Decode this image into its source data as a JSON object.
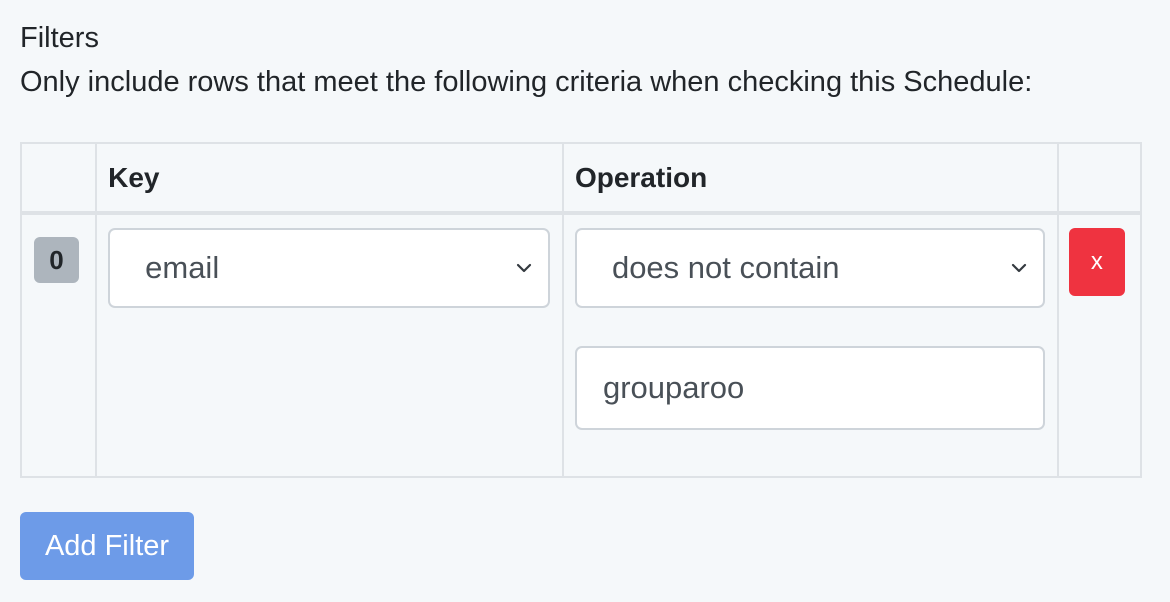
{
  "section": {
    "title": "Filters",
    "description": "Only include rows that meet the following criteria when checking this Schedule:"
  },
  "table": {
    "headers": {
      "index": "",
      "key": "Key",
      "operation": "Operation",
      "actions": ""
    },
    "rows": [
      {
        "index": "0",
        "key": "email",
        "operation": "does not contain",
        "match": "grouparoo",
        "remove_label": "x"
      }
    ]
  },
  "actions": {
    "add_filter_label": "Add Filter"
  },
  "colors": {
    "background": "#f5f8fa",
    "remove_button": "#ef3340",
    "add_button": "#6d9be8",
    "badge": "#adb5bd",
    "border": "#dee2e6"
  },
  "icons": {
    "select_arrow": "chevron-down-icon"
  }
}
